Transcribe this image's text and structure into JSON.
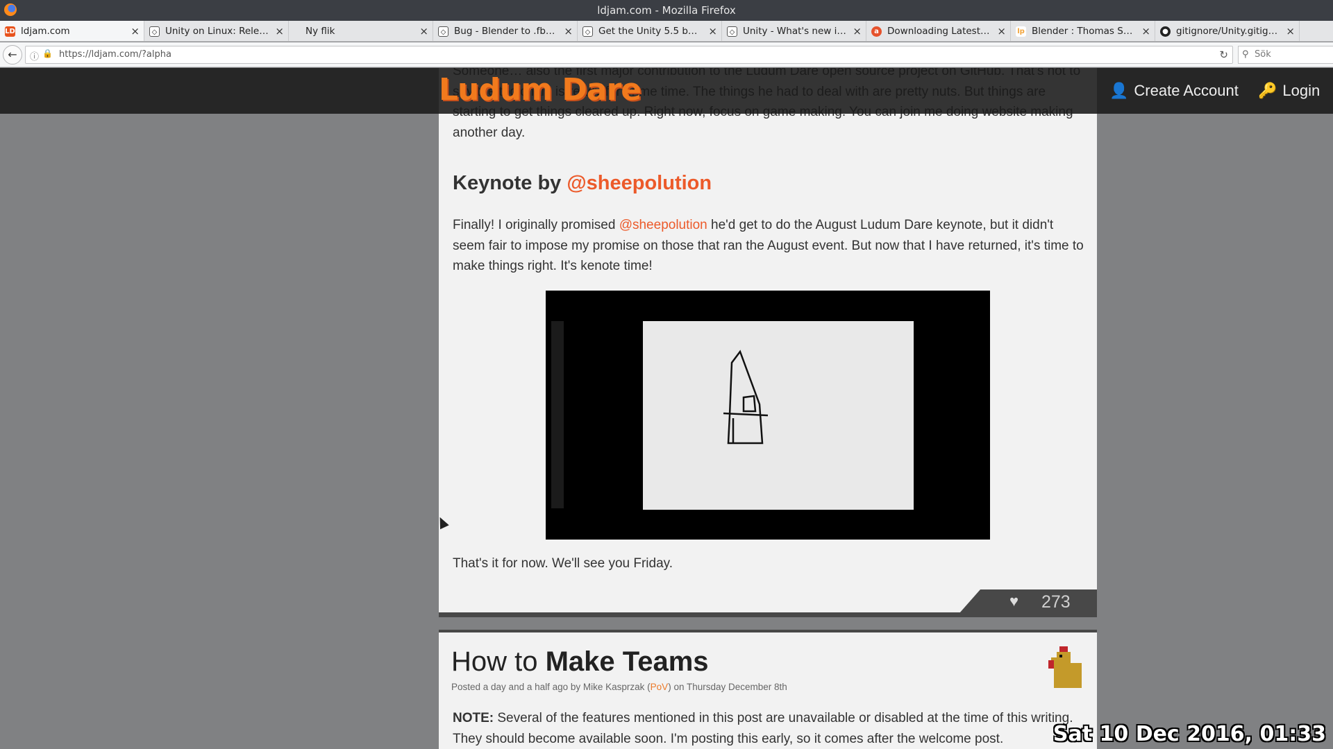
{
  "window": {
    "title": "ldjam.com - Mozilla Firefox"
  },
  "tabs": [
    {
      "label": "ldjam.com",
      "icon": "ludumdare-favicon",
      "color": "#e8531d",
      "active": true
    },
    {
      "label": "Unity on Linux: Release...",
      "icon": "unity-favicon",
      "color": "#222222"
    },
    {
      "label": "Ny flik",
      "icon": "none",
      "color": "#ffffff"
    },
    {
      "label": "Bug - Blender to .fbx pr...",
      "icon": "unity-favicon",
      "color": "#222222"
    },
    {
      "label": "Get the Unity 5.5 beta ...",
      "icon": "unity-favicon",
      "color": "#222222"
    },
    {
      "label": "Unity - What's new in U...",
      "icon": "unity-favicon",
      "color": "#222222"
    },
    {
      "label": "Downloading Latest Bl...",
      "icon": "askubuntu-favicon",
      "color": "#e6522c"
    },
    {
      "label": "Blender : Thomas Schiex",
      "icon": "launchpad-favicon",
      "color": "#f2a43a"
    },
    {
      "label": "gitignore/Unity.gitigno...",
      "icon": "github-favicon",
      "color": "#222222"
    }
  ],
  "nav": {
    "url": "https://ldjam.com/?alpha",
    "search_placeholder": "Sök"
  },
  "header": {
    "logo": "Ludum Dare",
    "create_account": "Create Account",
    "login": "Login"
  },
  "article": {
    "top_text": "Someone… also the first major contribution to the Ludum Dare open source project on GitHub. That's not to say the toolchain is ready for prime time. The things he had to deal with are pretty nuts. But things are starting to get things cleared up. Right now, focus on game making. You can join me doing website making another day.",
    "keynote_heading_prefix": "Keynote by ",
    "keynote_heading_mention": "@sheepolution",
    "para2_a": "Finally! I originally promised ",
    "para2_mention": "@sheepolution",
    "para2_b": " he'd get to do the August Ludum Dare keynote, but it didn't seem fair to impose my promise on those that ran the August event. But now that I have returned, it's time to make things right. It's kenote time!",
    "para3": "That's it for now. We'll see you Friday.",
    "likes": "273"
  },
  "post2": {
    "title_prefix": "How to ",
    "title_bold": "Make Teams",
    "meta_a": "Posted a day and a half ago by Mike Kasprzak (",
    "meta_link": "PoV",
    "meta_b": ") on Thursday December 8th",
    "body_bold": "NOTE:",
    "body": " Several of the features mentioned in this post are unavailable or disabled at the time of this writing. They should become available soon. I'm posting this early, so it comes after the welcome post."
  },
  "clock": "Sat 10 Dec 2016, 01:33"
}
